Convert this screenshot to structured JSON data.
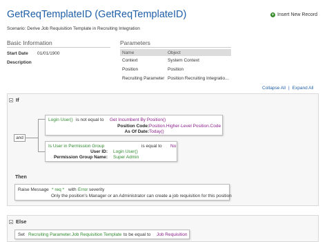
{
  "header": {
    "title": "GetReqTemplateID (GetReqTemplateID)",
    "insert_label": "Insert New Record",
    "scenario": "Scenario: Derive Job Requisition Template in Recruiting Integration"
  },
  "basic_info": {
    "heading": "Basic Information",
    "start_date_label": "Start Date",
    "start_date_value": "01/01/1900",
    "description_label": "Description"
  },
  "parameters": {
    "heading": "Parameters",
    "col_name": "Name",
    "col_object": "Object",
    "rows": [
      {
        "name": "Context",
        "object": "System Context"
      },
      {
        "name": "Position",
        "object": "Position"
      },
      {
        "name": "Recruiting Parameter",
        "object": "Position Recruiting Integratio..."
      }
    ]
  },
  "controls": {
    "collapse_all": "Collapse All",
    "separator": "|",
    "expand_all": "Expand All"
  },
  "if_block": {
    "label": "If",
    "operator": "and",
    "condition1": {
      "left": "Login User()",
      "op": "is not equal to",
      "right": "Get Incumbent By Position()",
      "params": [
        {
          "label": "Position Code:",
          "value": "Position.Higher-Level Position.Code"
        },
        {
          "label": "As Of Date:",
          "value": "Today()"
        }
      ]
    },
    "condition2": {
      "left": "Is User in Permission Group",
      "op": "is equal to",
      "right": "No",
      "params": [
        {
          "label": "User ID:",
          "value": "Login User()"
        },
        {
          "label": "Permission Group Name:",
          "value": "Super Admin"
        }
      ]
    }
  },
  "then_block": {
    "label": "Then",
    "raise_label": "Raise Message",
    "req_text": "* req *",
    "with_text": "with",
    "severity_value": "Error",
    "severity_text": "severity",
    "message": "Only the position's Manager or an Administrator can create a job requisition for this position"
  },
  "else_block": {
    "label": "Else",
    "set_label": "Set",
    "target": "Recruiting Parameter.Job Requisition Template",
    "to_text": "to be equal to",
    "value": "Job Requisition"
  },
  "colors": {
    "title_blue": "#1f5fa8",
    "field_green": "#2f8a2f",
    "value_purple": "#8a1f8a",
    "insert_icon_green": "#3a8a2e"
  },
  "icons": [
    "plus-circle-icon",
    "collapse-minus-icon"
  ]
}
